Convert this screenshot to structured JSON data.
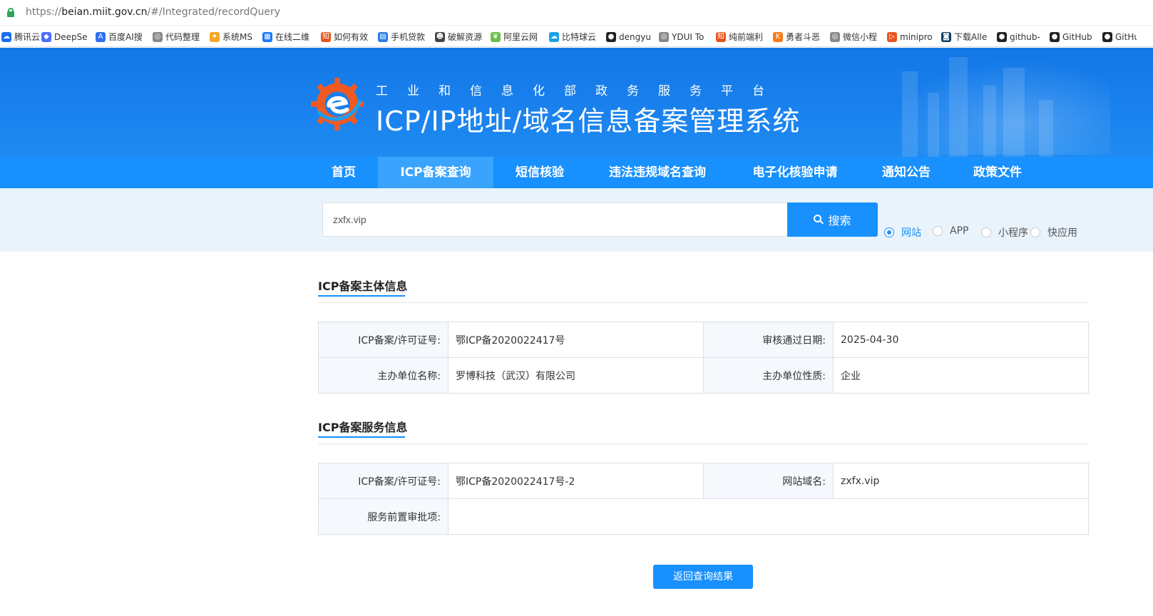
{
  "browser": {
    "url_prefix": "https://",
    "url_domain": "beian.miit.gov.cn",
    "url_path": "/#/Integrated/recordQuery"
  },
  "bookmarks": [
    {
      "label": "腾讯云AI",
      "icon": "tencent-icon",
      "color": "#1b6ef3",
      "w": 56
    },
    {
      "label": "DeepSe",
      "icon": "deepseek-icon",
      "color": "#4d6bfe",
      "w": 76
    },
    {
      "label": "百度AI搜",
      "icon": "baidu-ai-icon",
      "color": "#2f6ff0",
      "w": 80
    },
    {
      "label": "代码整理",
      "icon": "globe-icon",
      "color": "#888888",
      "w": 80
    },
    {
      "label": "系统MS",
      "icon": "tool-icon",
      "color": "#f6a623",
      "w": 74
    },
    {
      "label": "在线二维",
      "icon": "qr-icon",
      "color": "#1677ff",
      "w": 82
    },
    {
      "label": "如何有效",
      "icon": "zhihu-icon",
      "color": "#e8541e",
      "w": 80
    },
    {
      "label": "手机贷款",
      "icon": "doc-icon",
      "color": "#2b7be4",
      "w": 80
    },
    {
      "label": "破解资源",
      "icon": "skull-icon",
      "color": "#444444",
      "w": 78
    },
    {
      "label": "阿里云网",
      "icon": "leaf-icon",
      "color": "#6cc04a",
      "w": 82
    },
    {
      "label": "比特球云",
      "icon": "cloud-icon",
      "color": "#1aa0e8",
      "w": 80
    },
    {
      "label": "dengyu",
      "icon": "github-icon",
      "color": "#222222",
      "w": 74
    },
    {
      "label": "YDUI To",
      "icon": "globe-icon",
      "color": "#888888",
      "w": 80
    },
    {
      "label": "纯前端利",
      "icon": "zhihu-icon",
      "color": "#e8541e",
      "w": 80
    },
    {
      "label": "勇者斗恶",
      "icon": "k-icon",
      "color": "#f57c1f",
      "w": 80
    },
    {
      "label": "微信小程",
      "icon": "globe-icon",
      "color": "#888888",
      "w": 80
    },
    {
      "label": "minipro",
      "icon": "minipro-icon",
      "color": "#e8541e",
      "w": 76
    },
    {
      "label": "下载Alle",
      "icon": "download-icon",
      "color": "#0b3d66",
      "w": 78
    },
    {
      "label": "github-",
      "icon": "github-icon",
      "color": "#222222",
      "w": 74
    },
    {
      "label": "GitHub",
      "icon": "github-icon",
      "color": "#222222",
      "w": 74
    },
    {
      "label": "GitHu",
      "icon": "github-icon",
      "color": "#222222",
      "w": 50
    }
  ],
  "banner": {
    "subtitle": "工业和信息化部政务服务平台",
    "title": "ICP/IP地址/域名信息备案管理系统"
  },
  "nav": [
    {
      "label": "首页",
      "active": false
    },
    {
      "label": "ICP备案查询",
      "active": true
    },
    {
      "label": "短信核验",
      "active": false
    },
    {
      "label": "违法违规域名查询",
      "active": false
    },
    {
      "label": "电子化核验申请",
      "active": false
    },
    {
      "label": "通知公告",
      "active": false
    },
    {
      "label": "政策文件",
      "active": false
    }
  ],
  "search": {
    "value": "zxfx.vip",
    "button_label": "搜索",
    "options": [
      {
        "label": "网站",
        "checked": true
      },
      {
        "label": "APP",
        "checked": false
      },
      {
        "label": "小程序",
        "checked": false
      },
      {
        "label": "快应用",
        "checked": false
      }
    ]
  },
  "subject_info": {
    "title": "ICP备案主体信息",
    "license_label": "ICP备案/许可证号:",
    "license_value": "鄂ICP备2020022417号",
    "approve_date_label": "审核通过日期:",
    "approve_date_value": "2025-04-30",
    "org_name_label": "主办单位名称:",
    "org_name_value": "罗博科技（武汉）有限公司",
    "org_type_label": "主办单位性质:",
    "org_type_value": "企业"
  },
  "service_info": {
    "title": "ICP备案服务信息",
    "license_label": "ICP备案/许可证号:",
    "license_value": "鄂ICP备2020022417号-2",
    "domain_label": "网站域名:",
    "domain_value": "zxfx.vip",
    "pre_approval_label": "服务前置审批项:",
    "pre_approval_value": ""
  },
  "back_button_label": "返回查询结果",
  "colors": {
    "primary": "#1890fd",
    "nav_active": "#3aa3fd",
    "banner": "#1277e6",
    "logo_orange": "#f05a22"
  }
}
